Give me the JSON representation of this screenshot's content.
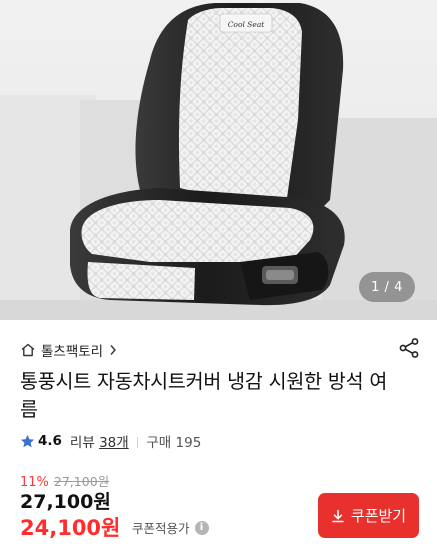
{
  "gallery": {
    "pager": "1 / 4",
    "seat_logo_text": "Cool Seat"
  },
  "store": {
    "name": "톨츠팩토리",
    "icons": {
      "home": "home-icon",
      "chevron": "chevron-right-icon",
      "share": "share-icon"
    }
  },
  "product": {
    "title": "통풍시트 자동차시트커버 냉감 시원한 방석 여름"
  },
  "rating": {
    "score": "4.6",
    "review_label": "리뷰",
    "review_count": "38개",
    "separator": "|",
    "purchase_label": "구매 195"
  },
  "price": {
    "discount_percent": "11%",
    "original": "27,100원",
    "sale": "27,100원",
    "coupon_price": "24,100원",
    "coupon_note": "쿠폰적용가",
    "info_glyph": "i"
  },
  "cta": {
    "label": "쿠폰받기",
    "color": "#e8302c"
  },
  "colors": {
    "accent_red": "#ff2d2d",
    "star_blue": "#3b6fd8"
  }
}
